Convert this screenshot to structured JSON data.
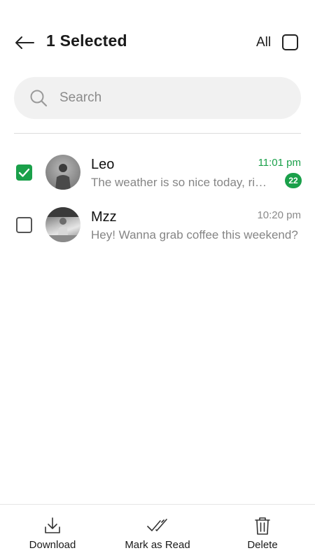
{
  "header": {
    "title": "1 Selected",
    "select_all_label": "All"
  },
  "search": {
    "placeholder": "Search"
  },
  "chats": [
    {
      "name": "Leo",
      "preview": "The weather is so nice today, right?",
      "time": "11:01 pm",
      "unread_count": "22",
      "selected": true
    },
    {
      "name": "Mzz",
      "preview": "Hey! Wanna grab coffee this weekend?",
      "time": "10:20 pm",
      "selected": false
    }
  ],
  "actions": {
    "download": "Download",
    "mark_read": "Mark as Read",
    "delete": "Delete"
  },
  "colors": {
    "accent": "#1aa04a",
    "search_bg": "#f1f1f1",
    "muted_text": "#858585"
  },
  "icons": {
    "back": "arrow-left-icon",
    "search": "search-icon",
    "check": "checkmark-icon",
    "download": "download-icon",
    "mark_read": "double-check-icon",
    "delete": "trash-icon"
  }
}
